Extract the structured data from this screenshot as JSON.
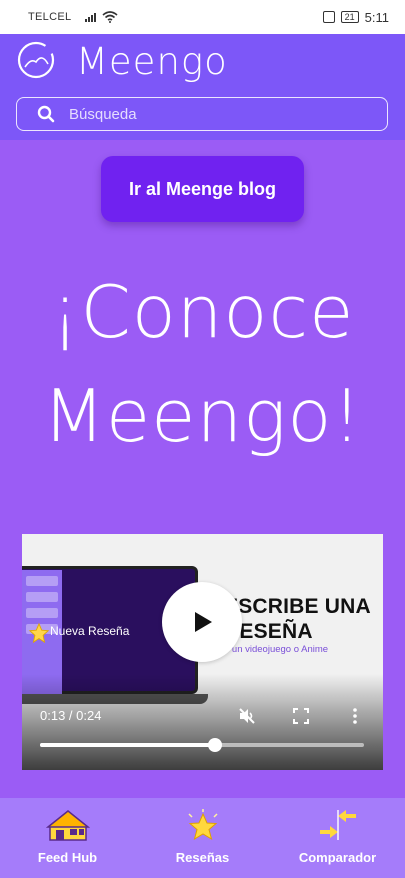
{
  "status_bar": {
    "carrier": "TELCEL",
    "battery": "21",
    "time": "5:11"
  },
  "header": {
    "app_title": "Meengo",
    "logo_icon": "meengo-logo-icon",
    "search": {
      "placeholder": "Búsqueda",
      "icon": "search-icon"
    }
  },
  "main": {
    "blog_button_label": "Ir al Meenge blog",
    "hero_line1": "¡Conoce",
    "hero_line2": "Meengo!"
  },
  "video": {
    "review_label": "Nueva Reseña",
    "headline_line1": "ESCRIBE UNA",
    "headline_line2": "RESEÑA",
    "subheadline": "e un videojuego o Anime",
    "time_display": "0:13 / 0:24",
    "progress_fraction": 0.54,
    "controls": [
      "play-icon",
      "mute-icon",
      "fullscreen-icon",
      "more-vert-icon"
    ]
  },
  "bottom_nav": {
    "items": [
      {
        "label": "Feed Hub",
        "icon": "house-icon"
      },
      {
        "label": "Reseñas",
        "icon": "star-icon"
      },
      {
        "label": "Comparador",
        "icon": "compare-arrows-icon"
      }
    ]
  },
  "colors": {
    "header_bg": "#7d57f8",
    "page_bg": "#9b5cf5",
    "button_bg": "#7022f0",
    "nav_bg": "#a57cfa"
  }
}
